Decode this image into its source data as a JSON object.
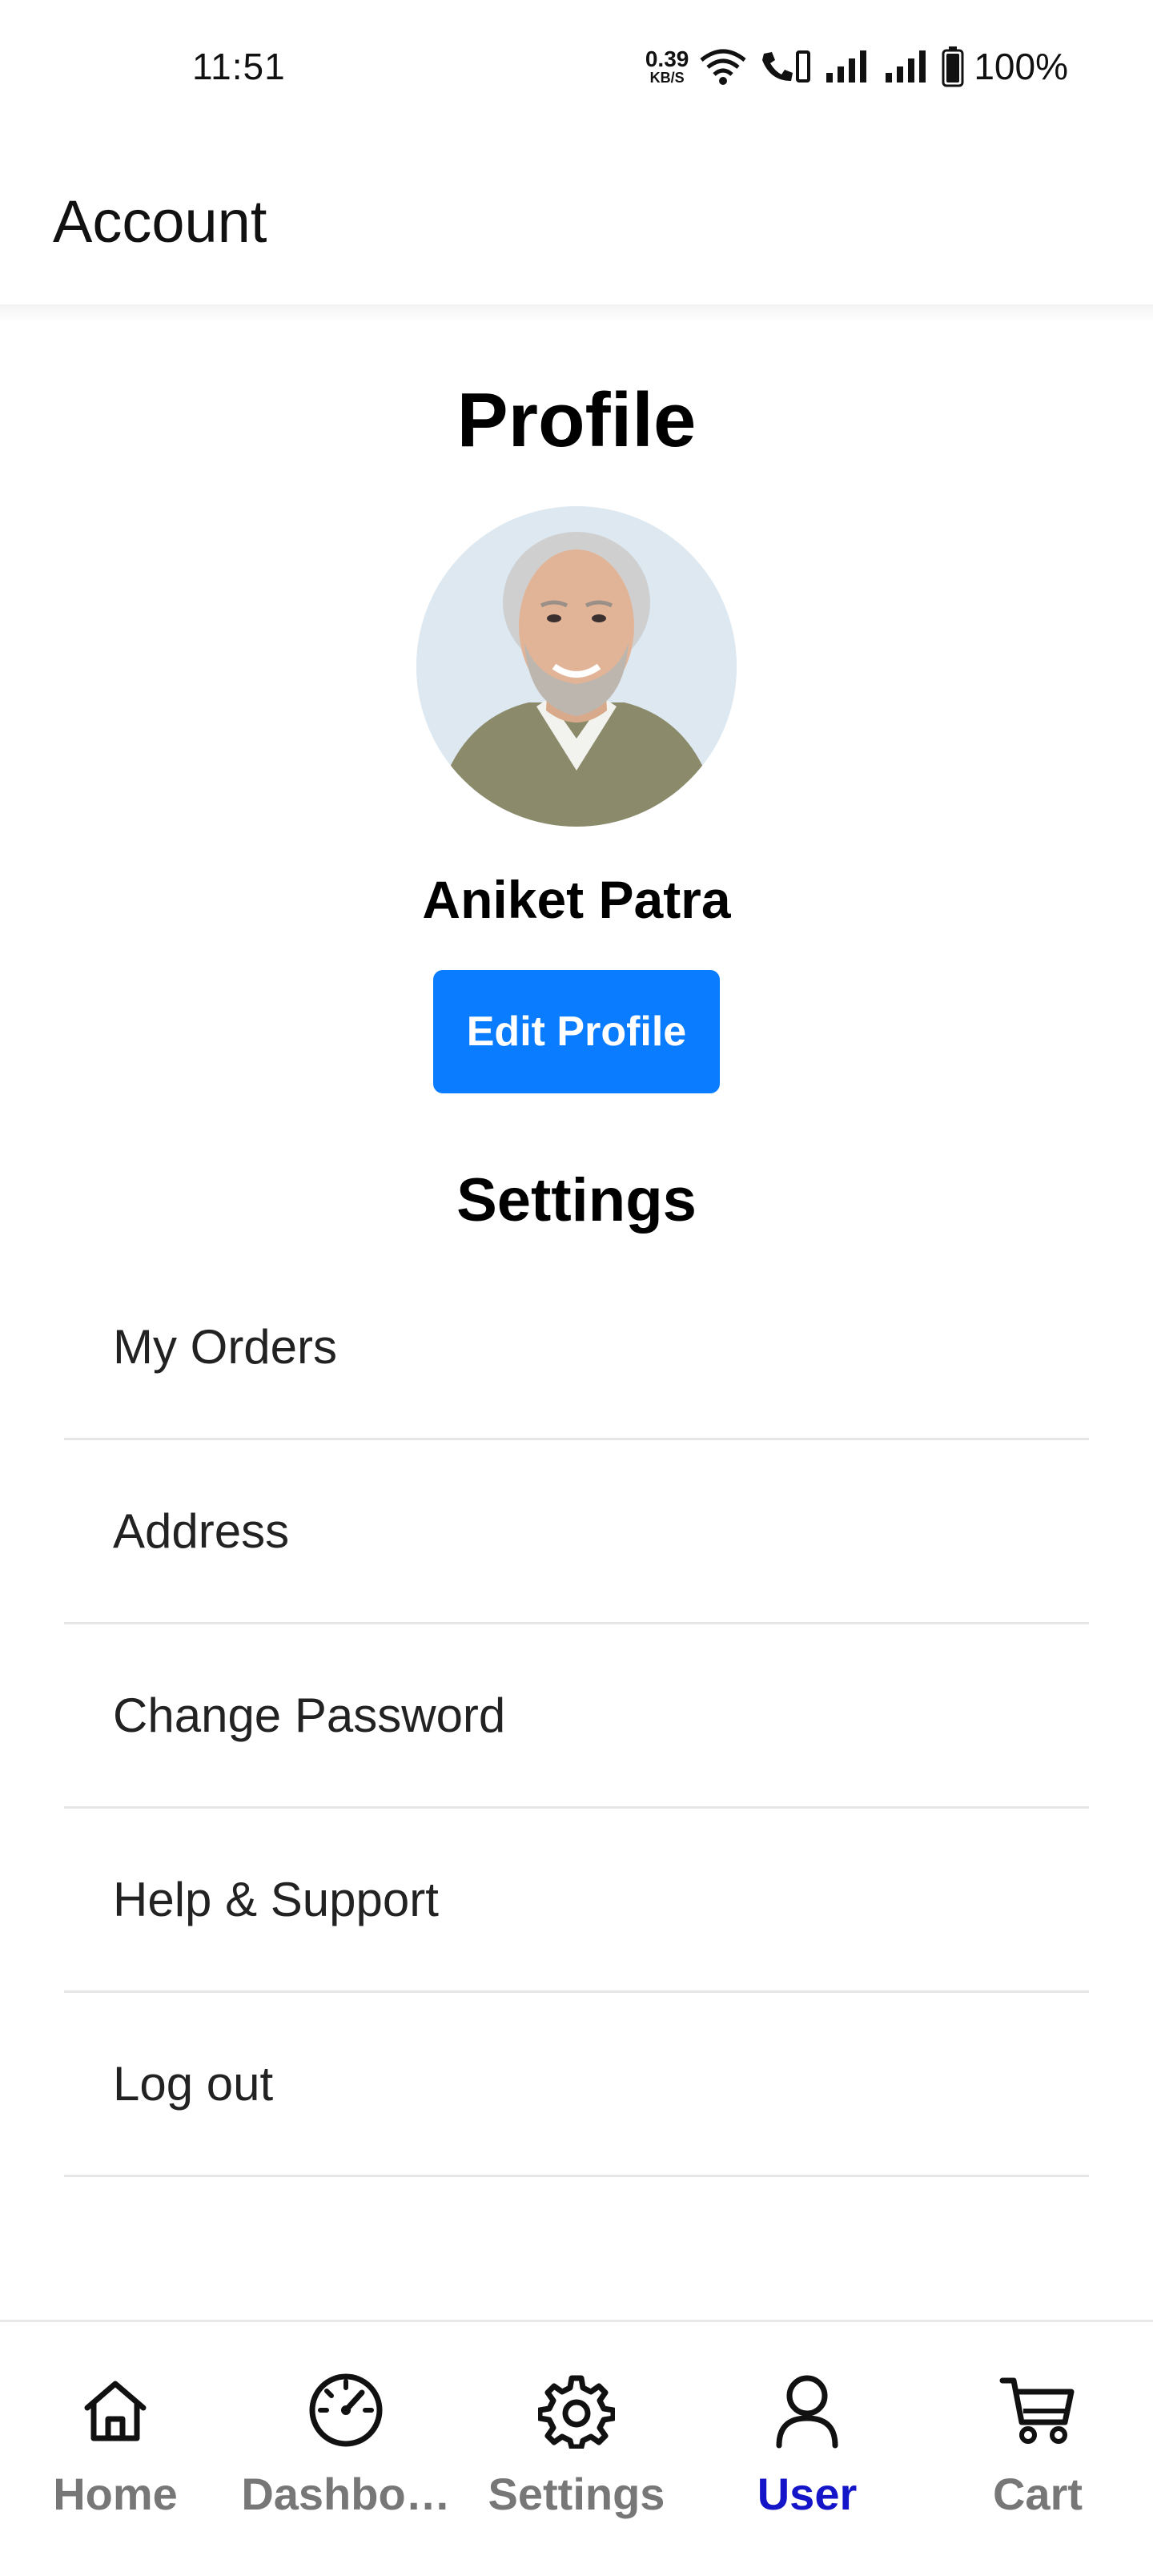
{
  "status_bar": {
    "time": "11:51",
    "net_speed_value": "0.39",
    "net_speed_unit": "KB/S",
    "battery_percent": "100%"
  },
  "header": {
    "title": "Account"
  },
  "profile": {
    "title": "Profile",
    "name": "Aniket Patra",
    "edit_button": "Edit Profile"
  },
  "settings": {
    "title": "Settings",
    "items": [
      {
        "label": "My Orders"
      },
      {
        "label": "Address"
      },
      {
        "label": "Change Password"
      },
      {
        "label": "Help & Support"
      },
      {
        "label": "Log out"
      }
    ]
  },
  "bottom_nav": {
    "active": "User",
    "items": [
      {
        "label": "Home",
        "icon": "home-icon"
      },
      {
        "label": "Dashbo…",
        "icon": "speedometer-icon"
      },
      {
        "label": "Settings",
        "icon": "gear-icon"
      },
      {
        "label": "User",
        "icon": "user-icon"
      },
      {
        "label": "Cart",
        "icon": "cart-icon"
      }
    ]
  },
  "colors": {
    "accent": "#0a7cff",
    "active_tab": "#1414c8",
    "inactive_tab": "#777777"
  }
}
